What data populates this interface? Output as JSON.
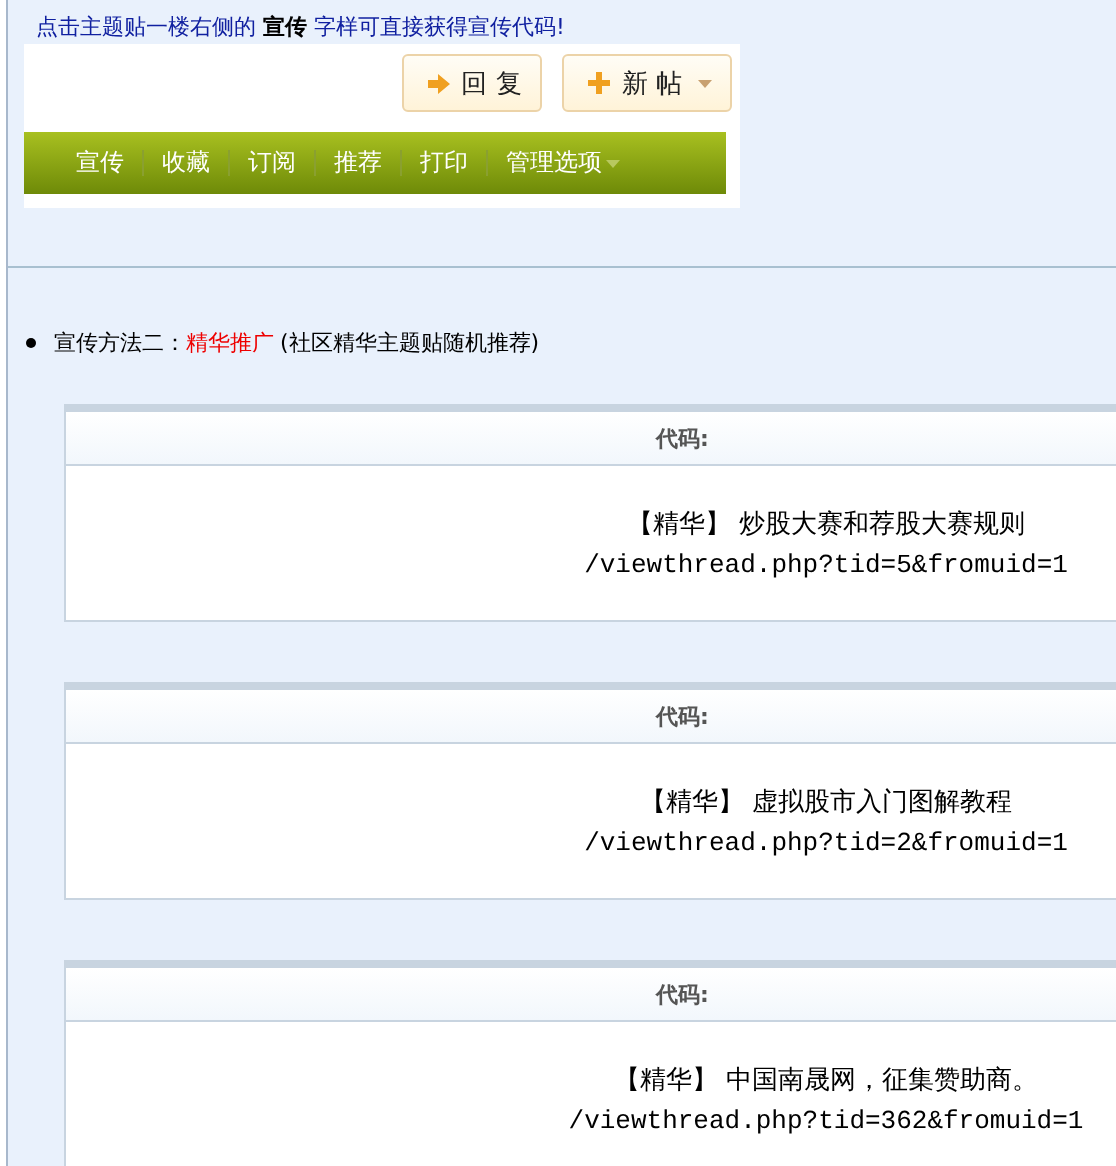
{
  "notice": "点击主题贴一楼右侧的 **宣传** 字样可直接获得宣传代码!",
  "toolbar_buttons": [
    {
      "label": "回 复",
      "kind": "reply",
      "dropdown": false
    },
    {
      "label": "新 帖",
      "kind": "new",
      "dropdown": true
    }
  ],
  "menu_items": [
    {
      "label": "宣传",
      "dropdown": false
    },
    {
      "label": "收藏",
      "dropdown": false
    },
    {
      "label": "订阅",
      "dropdown": false
    },
    {
      "label": "推荐",
      "dropdown": false
    },
    {
      "label": "打印",
      "dropdown": false
    },
    {
      "label": "管理选项",
      "dropdown": true
    }
  ],
  "method": {
    "label": "宣传方法二：",
    "highlight": "精华推广",
    "note": "(社区精华主题贴随机推荐)"
  },
  "code_blocks": [
    {
      "header": "代码:",
      "title": "【精华】 炒股大赛和荐股大赛规则",
      "url": "/viewthread.php?tid=5&fromuid=1"
    },
    {
      "header": "代码:",
      "title": "【精华】 虚拟股市入门图解教程",
      "url": "/viewthread.php?tid=2&fromuid=1"
    },
    {
      "header": "代码:",
      "title": "【精华】 中国南晟网，征集赞助商。",
      "url": "/viewthread.php?tid=362&fromuid=1"
    }
  ]
}
